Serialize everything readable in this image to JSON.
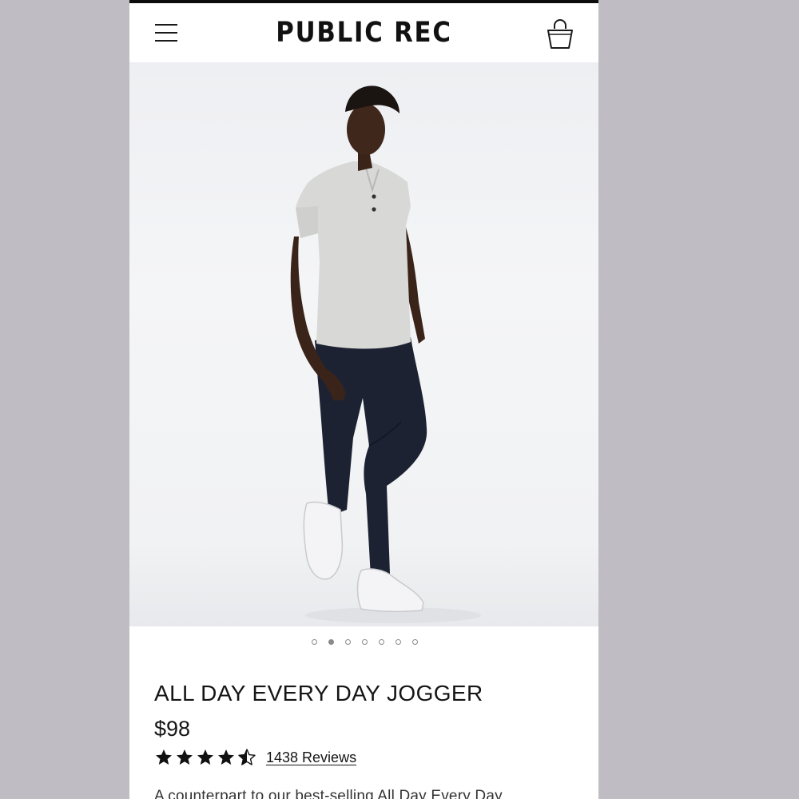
{
  "header": {
    "brand": "PUBLIC REC",
    "menu_icon": "hamburger-menu-icon",
    "cart_icon": "shopping-bag-icon"
  },
  "hero": {
    "image_icon": "product-photo-man-in-jogger",
    "carousel": {
      "count": 7,
      "active_index": 1
    }
  },
  "product": {
    "title": "ALL DAY EVERY DAY JOGGER",
    "price": "$98",
    "rating": 4.5,
    "rating_max": 5,
    "reviews_label": "1438 Reviews",
    "description": "A counterpart to our best-selling All Day Every Day"
  },
  "colors": {
    "frame_bg": "#bfbdc3",
    "accent": "#111111"
  }
}
